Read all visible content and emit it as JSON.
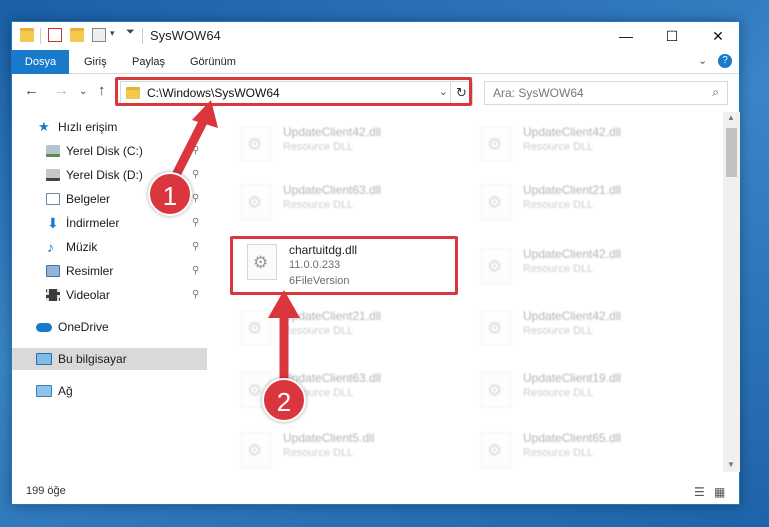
{
  "window": {
    "title": "SysWOW64",
    "min": "—",
    "max": "☐",
    "close": "✕"
  },
  "ribbon": {
    "tabs": [
      "Dosya",
      "Giriş",
      "Paylaş",
      "Görünüm"
    ],
    "expand": "⌄",
    "help": "?"
  },
  "nav": {
    "back": "←",
    "forward": "→",
    "recent": "⌄",
    "up": "↑",
    "address": "C:\\Windows\\SysWOW64",
    "address_dropdown": "⌄",
    "refresh": "↻",
    "search_placeholder": "Ara: SysWOW64",
    "search_icon": "⌕"
  },
  "sidebar": {
    "items": [
      {
        "label": "Hızlı erişim",
        "icon": "star-icon"
      },
      {
        "label": "Yerel Disk (C:)",
        "icon": "drive-icon",
        "pinned": true
      },
      {
        "label": "Yerel Disk (D:)",
        "icon": "drive-icon",
        "pinned": true
      },
      {
        "label": "Belgeler",
        "icon": "documents-icon",
        "pinned": true
      },
      {
        "label": "İndirmeler",
        "icon": "downloads-icon",
        "pinned": true
      },
      {
        "label": "Müzik",
        "icon": "music-icon",
        "pinned": true
      },
      {
        "label": "Resimler",
        "icon": "pictures-icon",
        "pinned": true
      },
      {
        "label": "Videolar",
        "icon": "videos-icon",
        "pinned": true
      },
      {
        "label": "OneDrive",
        "icon": "cloud-icon"
      },
      {
        "label": "Bu bilgisayar",
        "icon": "computer-icon",
        "selected": true
      },
      {
        "label": "Ağ",
        "icon": "network-icon"
      }
    ],
    "pin_glyph": "📌"
  },
  "files": [
    {
      "name": "UpdateClient42.dll",
      "type": "Resource DLL"
    },
    {
      "name": "UpdateClient42.dll",
      "type": "Resource DLL"
    },
    {
      "name": "UpdateClient63.dll",
      "type": "Resource DLL"
    },
    {
      "name": "UpdateClient21.dll",
      "type": "Resource DLL"
    },
    {
      "name": "chartuitdg.dll",
      "type": "11.0.0.233",
      "line3": "6FileVersion"
    },
    {
      "name": "UpdateClient42.dll",
      "type": "Resource DLL"
    },
    {
      "name": "UpdateClient21.dll",
      "type": "Resource DLL"
    },
    {
      "name": "UpdateClient42.dll",
      "type": "Resource DLL"
    },
    {
      "name": "UpdateClient63.dll",
      "type": "Resource DLL"
    },
    {
      "name": "UpdateClient19.dll",
      "type": "Resource DLL"
    },
    {
      "name": "UpdateClient5.dll",
      "type": "Resource DLL"
    },
    {
      "name": "UpdateClient65.dll",
      "type": "Resource DLL"
    }
  ],
  "status": {
    "count": "199 öğe",
    "details_icon": "☰",
    "tiles_icon": "▦"
  },
  "annotations": {
    "badge1": "1",
    "badge2": "2",
    "color": "#d9363e"
  }
}
